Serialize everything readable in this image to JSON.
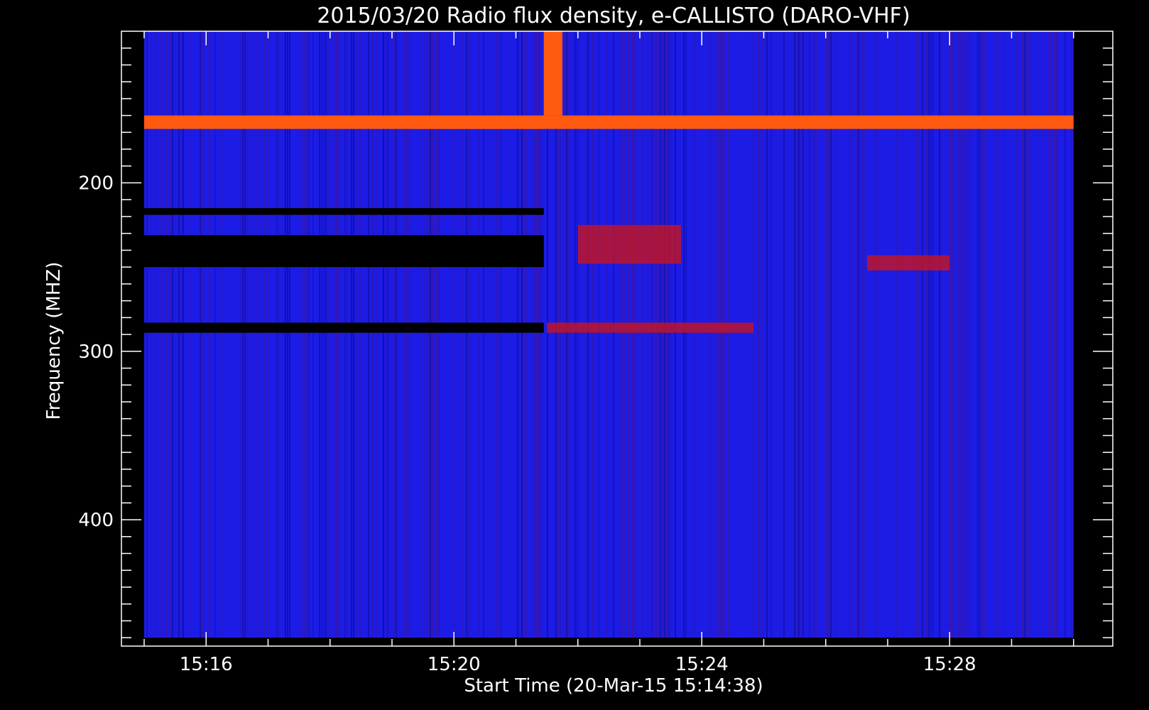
{
  "chart_data": {
    "type": "heatmap",
    "title": "2015/03/20  Radio flux density, e-CALLISTO (DARO-VHF)",
    "xlabel": "Start Time (20-Mar-15 15:14:38)",
    "ylabel": "Frequency (MHZ)",
    "xlim": [
      "15:14:38",
      "15:30:38"
    ],
    "ylim": [
      110,
      475
    ],
    "y_reversed": true,
    "x_ticks": [
      "15:16",
      "15:20",
      "15:24",
      "15:28"
    ],
    "x_tick_minutes": [
      16,
      20,
      24,
      28
    ],
    "y_ticks": [
      200,
      300,
      400
    ],
    "data_extent": {
      "t_start": "15:15:00",
      "t_end": "15:30:00",
      "f_min": 110,
      "f_max": 470
    },
    "colors": {
      "background": "#1c1ce6",
      "low": "#000000",
      "mid": "#c8141e",
      "high": "#ff5a10",
      "peak": "#ffff64"
    },
    "features": [
      {
        "name": "Interference band",
        "t_start": "15:15:00",
        "t_end": "15:30:00",
        "f_min": 160,
        "f_max": 168,
        "level": "high"
      },
      {
        "name": "Broadband burst",
        "t_start": "15:21:27",
        "t_end": "15:21:45",
        "f_min": 110,
        "f_max": 160,
        "level": "high"
      },
      {
        "name": "Emission patch",
        "t_start": "15:19:20",
        "t_end": "15:21:27",
        "f_min": 163,
        "f_max": 168,
        "level": "high"
      },
      {
        "name": "Drifting feature",
        "t_start": "15:21:30",
        "t_end": "15:24:50",
        "f_min": 283,
        "f_max": 289,
        "level": "mid"
      },
      {
        "name": "Emission patch",
        "t_start": "15:22:00",
        "t_end": "15:23:40",
        "f_min": 225,
        "f_max": 248,
        "level": "mid"
      },
      {
        "name": "Emission patch",
        "t_start": "15:26:40",
        "t_end": "15:28:00",
        "f_min": 243,
        "f_max": 252,
        "level": "mid"
      },
      {
        "name": "Low-signal gap",
        "t_start": "15:15:00",
        "t_end": "15:21:27",
        "f_min": 231,
        "f_max": 250,
        "level": "low"
      },
      {
        "name": "Low-signal gap",
        "t_start": "15:15:00",
        "t_end": "15:21:27",
        "f_min": 283,
        "f_max": 289,
        "level": "low"
      },
      {
        "name": "Low-signal gap",
        "t_start": "15:15:00",
        "t_end": "15:21:27",
        "f_min": 215,
        "f_max": 219,
        "level": "low"
      }
    ]
  }
}
